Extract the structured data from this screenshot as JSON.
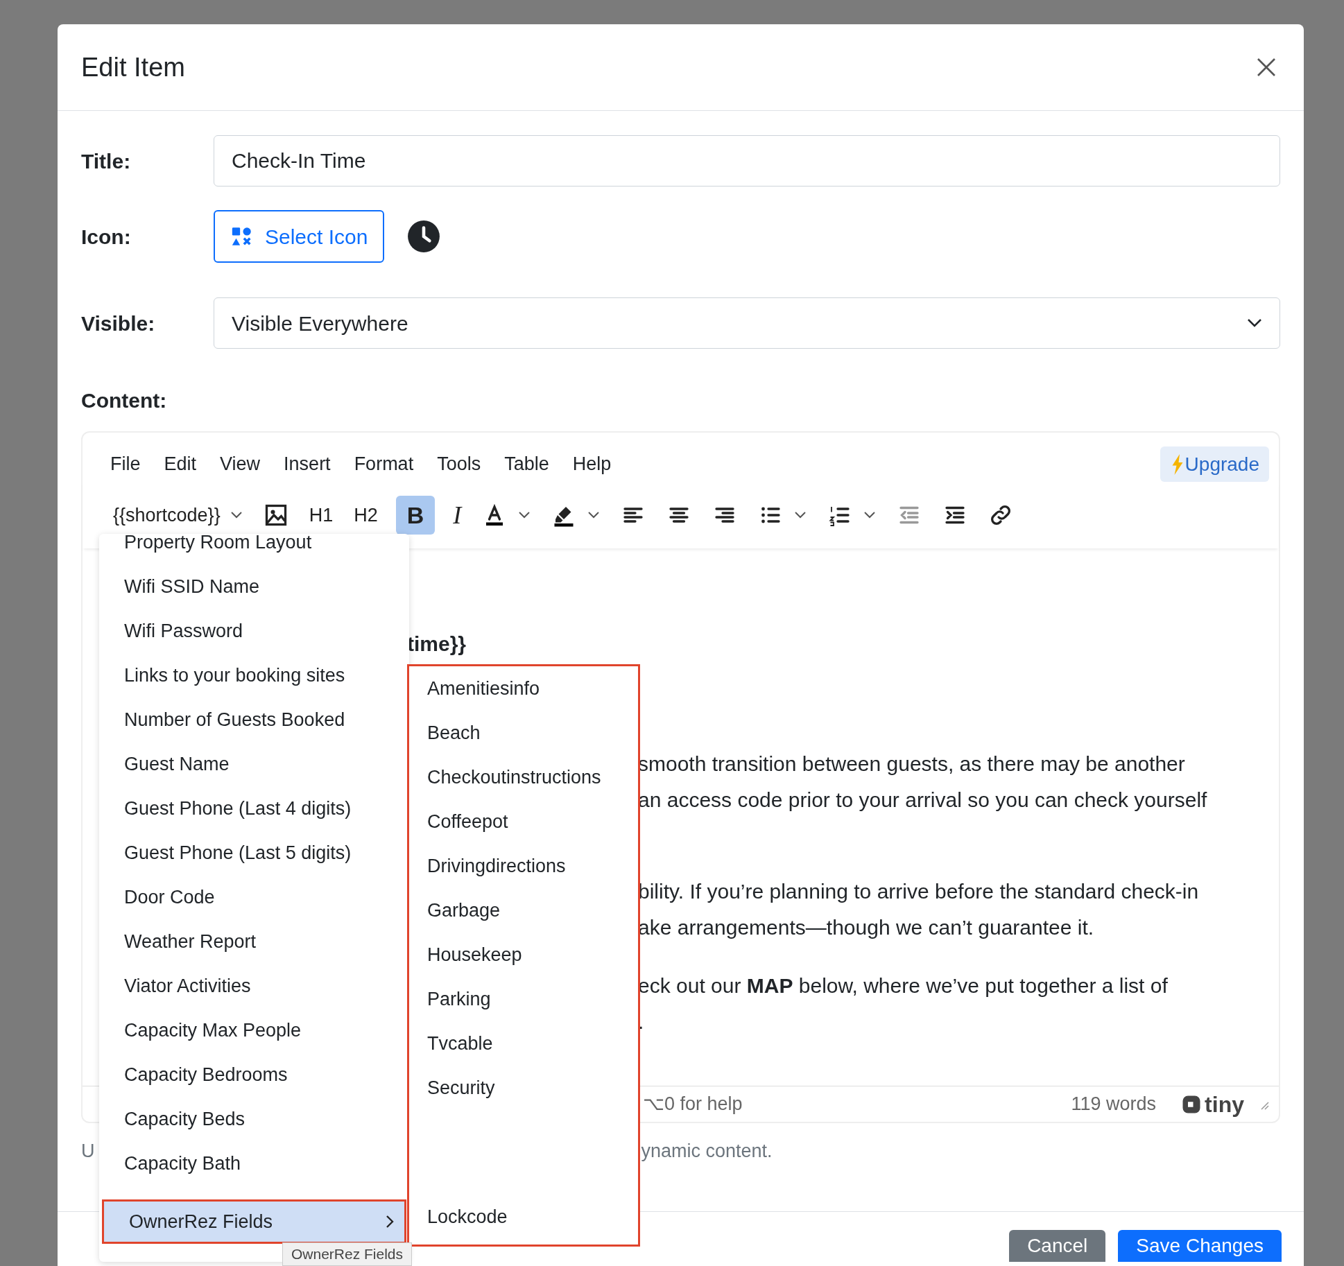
{
  "dialog": {
    "title": "Edit Item"
  },
  "form": {
    "title_label": "Title:",
    "title_value": "Check-In Time",
    "icon_label": "Icon:",
    "select_icon_button": "Select Icon",
    "visible_label": "Visible:",
    "visible_value": "Visible Everywhere",
    "content_label": "Content:"
  },
  "editor": {
    "menubar": [
      "File",
      "Edit",
      "View",
      "Insert",
      "Format",
      "Tools",
      "Table",
      "Help"
    ],
    "upgrade": "Upgrade",
    "toolbar": [
      {
        "kind": "dropdown",
        "label": "{{shortcode}}",
        "active": false,
        "disabled": false
      },
      {
        "kind": "image",
        "active": false,
        "disabled": false
      },
      {
        "kind": "text",
        "label": "H1",
        "active": false,
        "disabled": false
      },
      {
        "kind": "text",
        "label": "H2",
        "active": false,
        "disabled": false
      },
      {
        "kind": "bold",
        "label": "B",
        "active": true,
        "disabled": false
      },
      {
        "kind": "italic",
        "label": "I",
        "active": false,
        "disabled": false
      },
      {
        "kind": "text-color",
        "active": false,
        "disabled": false
      },
      {
        "kind": "highlight",
        "active": false,
        "disabled": false
      },
      {
        "kind": "align-left",
        "active": false,
        "disabled": false
      },
      {
        "kind": "align-center",
        "active": false,
        "disabled": false
      },
      {
        "kind": "align-right",
        "active": false,
        "disabled": false
      },
      {
        "kind": "bullet-list",
        "active": false,
        "disabled": false
      },
      {
        "kind": "numbered-list",
        "active": false,
        "disabled": false
      },
      {
        "kind": "outdent",
        "active": false,
        "disabled": true
      },
      {
        "kind": "indent",
        "active": false,
        "disabled": false
      },
      {
        "kind": "link",
        "active": false,
        "disabled": false
      }
    ],
    "body": [
      {
        "kind": "heading",
        "text": "time}}"
      },
      {
        "kind": "paragraph",
        "lines": [
          "smooth transition between guests, as there may be another",
          "an access code prior to your arrival so you can check yourself"
        ]
      },
      {
        "kind": "paragraph",
        "lines": [
          "bility. If you’re planning to arrive before the standard check-in",
          "ake arrangements—though we can’t guarantee it."
        ]
      },
      {
        "kind": "paragraph",
        "lines": [
          "eck out our **MAP** below, where we’ve put together a list of",
          "."
        ]
      }
    ],
    "status_bar": {
      "help": "⌥0 for help",
      "word_count": "119 words",
      "brand": "tiny"
    }
  },
  "hint": {
    "left": "U",
    "right": "ynamic content."
  },
  "shortcode_menu": {
    "items": [
      {
        "label": "Property Room Layout",
        "selected": false,
        "has_submenu": false,
        "outlined": false
      },
      {
        "label": "Wifi SSID Name",
        "selected": false,
        "has_submenu": false,
        "outlined": false
      },
      {
        "label": "Wifi Password",
        "selected": false,
        "has_submenu": false,
        "outlined": false
      },
      {
        "label": "Links to your booking sites",
        "selected": false,
        "has_submenu": false,
        "outlined": false
      },
      {
        "label": "Number of Guests Booked",
        "selected": false,
        "has_submenu": false,
        "outlined": false
      },
      {
        "label": "Guest Name",
        "selected": false,
        "has_submenu": false,
        "outlined": false
      },
      {
        "label": "Guest Phone (Last 4 digits)",
        "selected": false,
        "has_submenu": false,
        "outlined": false
      },
      {
        "label": "Guest Phone (Last 5 digits)",
        "selected": false,
        "has_submenu": false,
        "outlined": false
      },
      {
        "label": "Door Code",
        "selected": false,
        "has_submenu": false,
        "outlined": false
      },
      {
        "label": "Weather Report",
        "selected": false,
        "has_submenu": false,
        "outlined": false
      },
      {
        "label": "Viator Activities",
        "selected": false,
        "has_submenu": false,
        "outlined": false
      },
      {
        "label": "Capacity Max People",
        "selected": false,
        "has_submenu": false,
        "outlined": false
      },
      {
        "label": "Capacity Bedrooms",
        "selected": false,
        "has_submenu": false,
        "outlined": false
      },
      {
        "label": "Capacity Beds",
        "selected": false,
        "has_submenu": false,
        "outlined": false
      },
      {
        "label": "Capacity Bath",
        "selected": false,
        "has_submenu": false,
        "outlined": false
      },
      {
        "label": "OwnerRez Fields",
        "selected": true,
        "has_submenu": true,
        "outlined": true
      }
    ]
  },
  "submenu": {
    "outlined": true,
    "items": [
      "Amenitiesinfo",
      "Beach",
      "Checkoutinstructions",
      "Coffeepot",
      "Drivingdirections",
      "Garbage",
      "Housekeep",
      "Parking",
      "Tvcable",
      "Security"
    ],
    "bottom_items": [
      "Lockcode"
    ]
  },
  "tooltip": "OwnerRez Fields",
  "footer": {
    "cancel": "Cancel",
    "save": "Save Changes"
  }
}
